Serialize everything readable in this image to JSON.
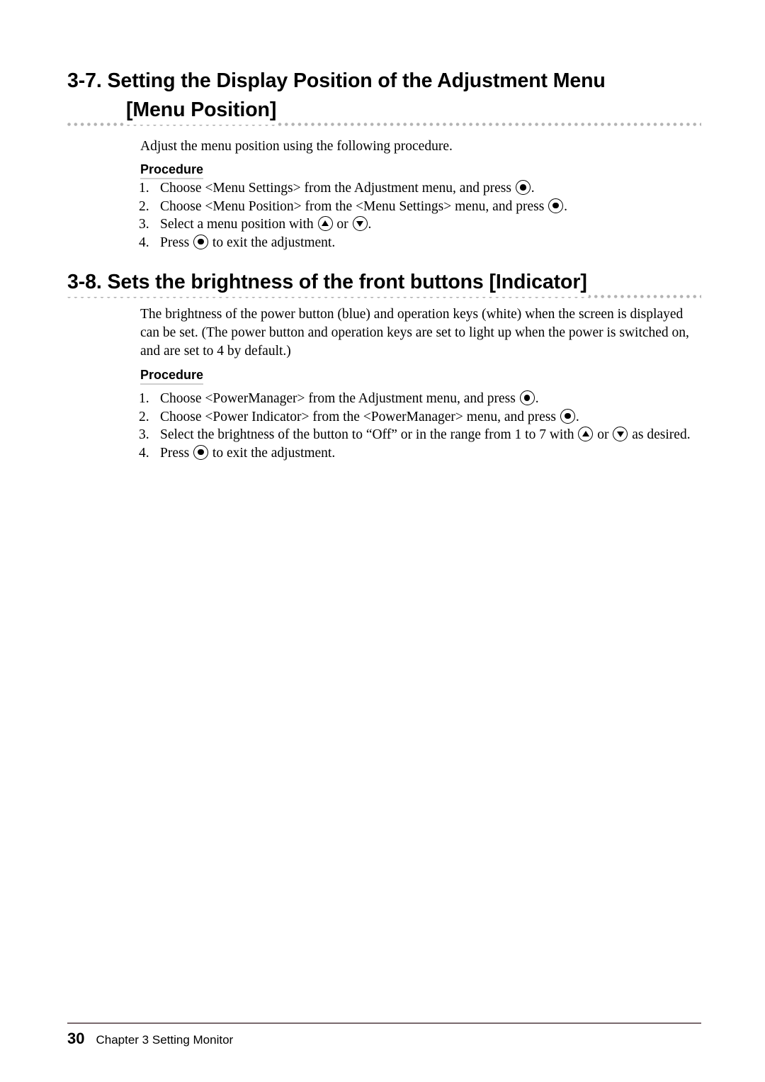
{
  "document": {
    "sections": [
      {
        "id": "menu-position",
        "heading_line1": "3-7. Setting the Display Position of the Adjustment Menu",
        "heading_line2": "[Menu Position]",
        "intro": "Adjust the menu position using the following procedure.",
        "procedure_label": "Procedure",
        "steps": [
          {
            "number": "1.",
            "parts": [
              {
                "type": "text",
                "value": "Choose <Menu Settings> from the Adjustment menu, and press "
              },
              {
                "type": "icon",
                "value": "enter-button-icon"
              },
              {
                "type": "text",
                "value": "."
              }
            ]
          },
          {
            "number": "2.",
            "parts": [
              {
                "type": "text",
                "value": "Choose <Menu Position> from the <Menu Settings> menu, and press "
              },
              {
                "type": "icon",
                "value": "enter-button-icon"
              },
              {
                "type": "text",
                "value": "."
              }
            ]
          },
          {
            "number": "3.",
            "parts": [
              {
                "type": "text",
                "value": "Select a menu position with "
              },
              {
                "type": "icon",
                "value": "up-button-icon"
              },
              {
                "type": "text",
                "value": " or "
              },
              {
                "type": "icon",
                "value": "down-button-icon"
              },
              {
                "type": "text",
                "value": "."
              }
            ]
          },
          {
            "number": "4.",
            "parts": [
              {
                "type": "text",
                "value": "Press "
              },
              {
                "type": "icon",
                "value": "enter-button-icon"
              },
              {
                "type": "text",
                "value": " to exit the adjustment."
              }
            ]
          }
        ]
      },
      {
        "id": "indicator",
        "heading_line1": "3-8. Sets the brightness of the front buttons [Indicator]",
        "heading_line2": "",
        "intro": "The brightness of the power button (blue) and operation keys (white) when the screen is displayed can be set. (The power button and operation keys are set to light up when the power is switched on, and are set to 4 by default.)",
        "procedure_label": "Procedure",
        "steps": [
          {
            "number": "1.",
            "parts": [
              {
                "type": "text",
                "value": "Choose <PowerManager> from the Adjustment menu, and press "
              },
              {
                "type": "icon",
                "value": "enter-button-icon"
              },
              {
                "type": "text",
                "value": "."
              }
            ]
          },
          {
            "number": "2.",
            "parts": [
              {
                "type": "text",
                "value": "Choose <Power Indicator> from the <PowerManager> menu, and press "
              },
              {
                "type": "icon",
                "value": "enter-button-icon"
              },
              {
                "type": "text",
                "value": "."
              }
            ]
          },
          {
            "number": "3.",
            "parts": [
              {
                "type": "text",
                "value": "Select the brightness of the button to “Off” or in the range from 1 to 7 with "
              },
              {
                "type": "icon",
                "value": "up-button-icon"
              },
              {
                "type": "text",
                "value": " or "
              },
              {
                "type": "icon",
                "value": "down-button-icon"
              },
              {
                "type": "text",
                "value": " as desired."
              }
            ]
          },
          {
            "number": "4.",
            "parts": [
              {
                "type": "text",
                "value": "Press "
              },
              {
                "type": "icon",
                "value": "enter-button-icon"
              },
              {
                "type": "text",
                "value": " to exit the adjustment."
              }
            ]
          }
        ]
      }
    ],
    "footer": {
      "page_number": "30",
      "chapter_text": "Chapter 3  Setting Monitor",
      "rule_color": "#7a6a6e"
    },
    "styles": {
      "leader_dot_color": "#b3b3b3",
      "procedure_underline_color": "#cfcfcf",
      "text_color": "#000000",
      "background_color": "#ffffff"
    }
  }
}
